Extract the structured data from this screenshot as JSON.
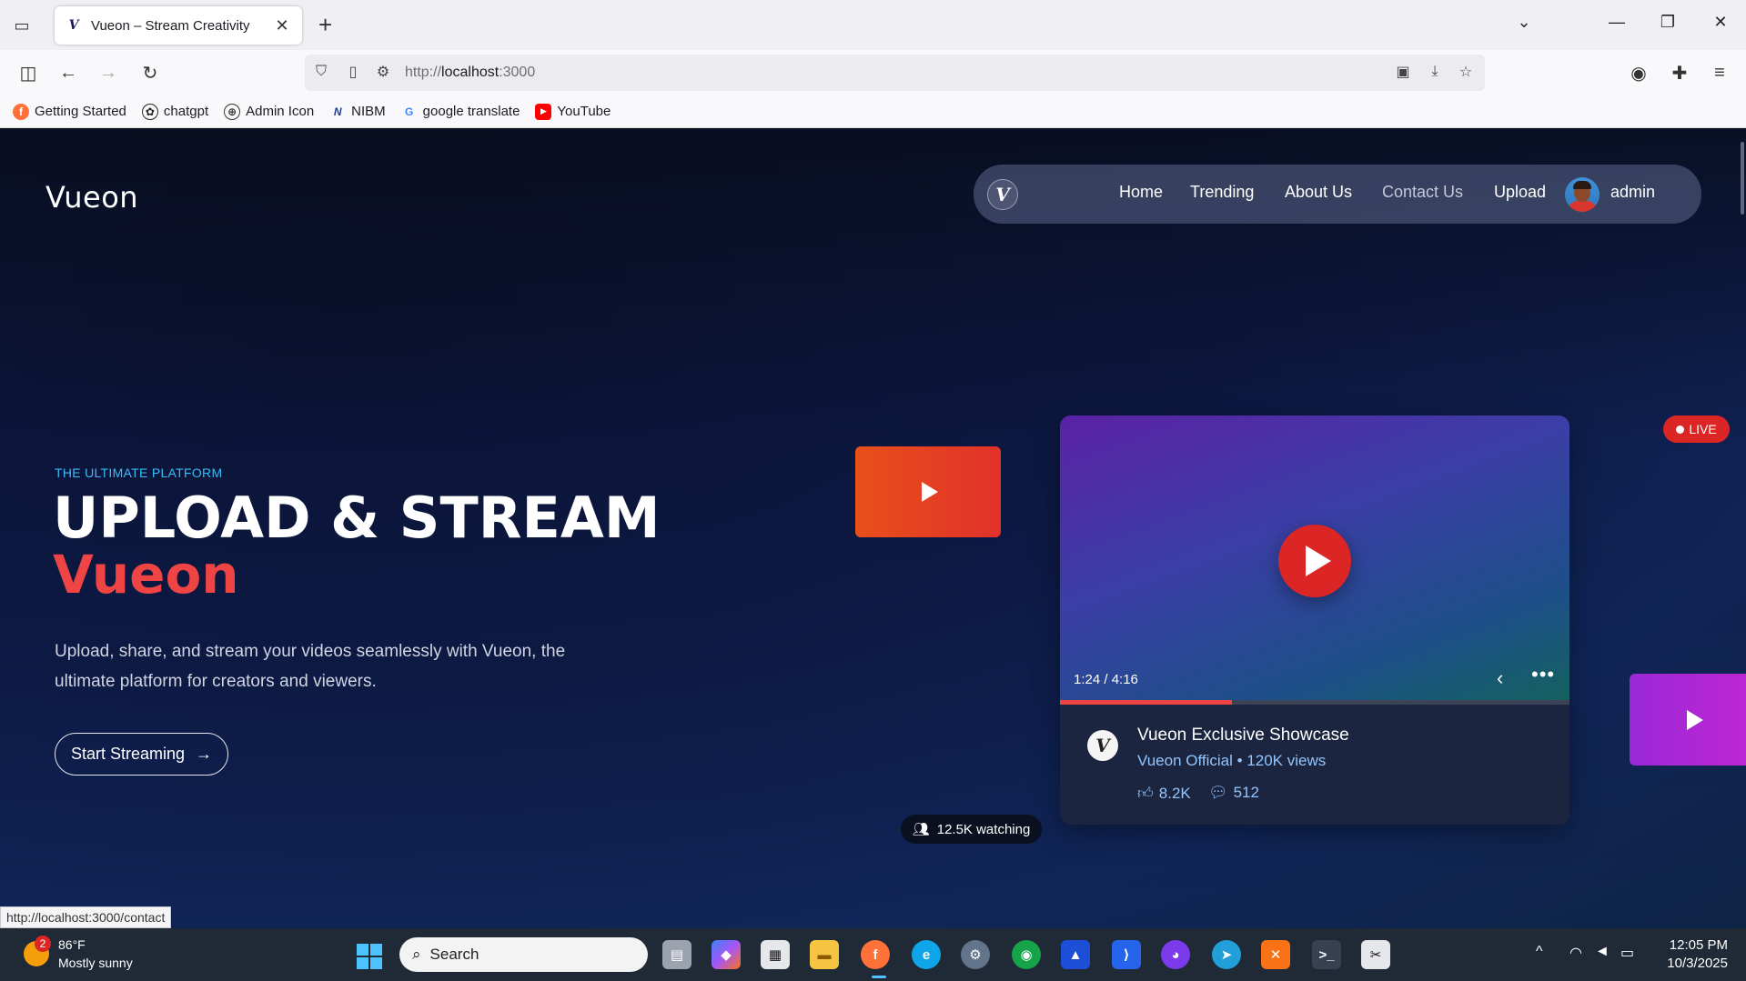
{
  "browser": {
    "tab_title": "Vueon – Stream Creativity",
    "url_prefix": "http://",
    "url_host": "localhost",
    "url_port": ":3000",
    "bookmarks": [
      "Getting Started",
      "chatgpt",
      "Admin Icon",
      "NIBM",
      "google translate",
      "YouTube"
    ],
    "status_url": "http://localhost:3000/contact"
  },
  "site": {
    "logo": "Vueon",
    "nav": {
      "home": "Home",
      "trending": "Trending",
      "about": "About Us",
      "contact": "Contact Us",
      "upload": "Upload",
      "user": "admin"
    },
    "hero": {
      "eyebrow": "THE ULTIMATE PLATFORM",
      "title": "UPLOAD & STREAM",
      "accent": "Vueon",
      "description": "Upload, share, and stream your videos seamlessly with Vueon, the ultimate platform for creators and viewers.",
      "cta": "Start Streaming"
    },
    "player": {
      "time": "1:24 / 4:16",
      "progress_fraction": 0.337,
      "title": "Vueon Exclusive Showcase",
      "meta": "Vueon Official • 120K views",
      "likes": "8.2K",
      "comments": "512"
    },
    "live_label": "LIVE",
    "watching": "12.5K watching"
  },
  "taskbar": {
    "weather_badge": "2",
    "temp": "86°F",
    "condition": "Mostly sunny",
    "search": "Search",
    "time": "12:05 PM",
    "date": "10/3/2025"
  },
  "colors": {
    "accent_red": "#ef4444",
    "eyebrow_blue": "#38bdf8"
  }
}
